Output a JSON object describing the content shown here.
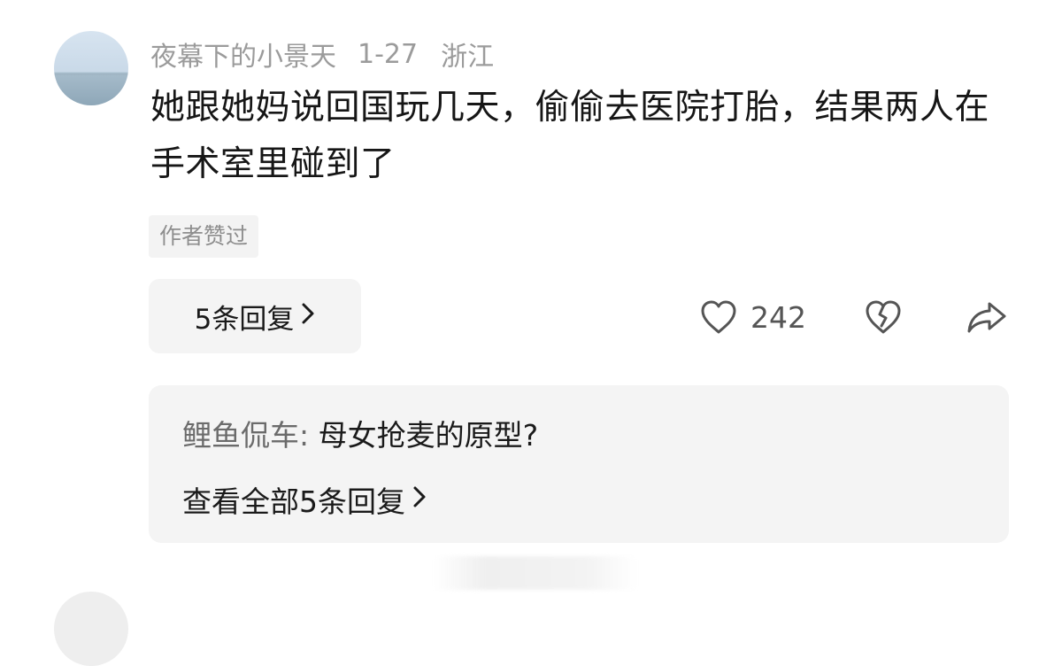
{
  "comment": {
    "username": "夜幕下的小景天",
    "date": "1-27",
    "location": "浙江",
    "text": "她跟她妈说回国玩几天，偷偷去医院打胎，结果两人在手术室里碰到了",
    "author_badge": "作者赞过",
    "reply_button_label": "5条回复",
    "like_count": "242"
  },
  "reply_preview": {
    "author": "鲤鱼侃车",
    "separator": ": ",
    "text": "母女抢麦的原型?",
    "view_all_label": "查看全部5条回复"
  },
  "icons": {
    "chevron": "chevron-right-icon",
    "like": "heart-outline-icon",
    "dislike": "broken-heart-icon",
    "share": "share-arrow-icon"
  }
}
